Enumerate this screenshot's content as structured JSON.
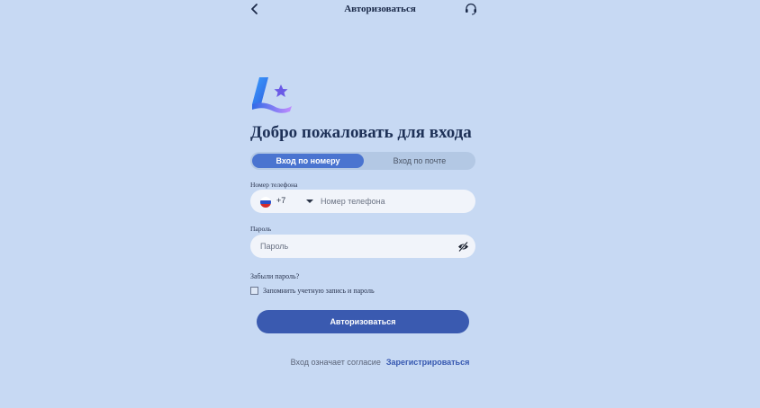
{
  "header": {
    "title": "Авторизоваться"
  },
  "welcome": "Добро пожаловать для входа",
  "tabs": [
    {
      "label": "Вход по номеру",
      "active": true
    },
    {
      "label": "Вход по почте",
      "active": false
    }
  ],
  "phone": {
    "label": "Номер телефона",
    "country_code": "+7",
    "placeholder": "Номер телефона"
  },
  "password": {
    "label": "Пароль",
    "placeholder": "Пароль"
  },
  "forgot_label": "Забыли пароль?",
  "remember_label": "Запомнить учетную запись и пароль",
  "login_button": "Авторизоваться",
  "footer": {
    "agree_text": "Вход означает согласие",
    "register_link": "Зарегистрироваться"
  },
  "colors": {
    "background": "#c7d9f3",
    "accent": "#4a74d0",
    "button": "#3a5ab0"
  },
  "icons": {
    "back": "chevron-left-icon",
    "support": "headset-icon",
    "flag": "russia-flag-icon",
    "dropdown": "caret-down-icon",
    "visibility": "eye-off-icon"
  }
}
